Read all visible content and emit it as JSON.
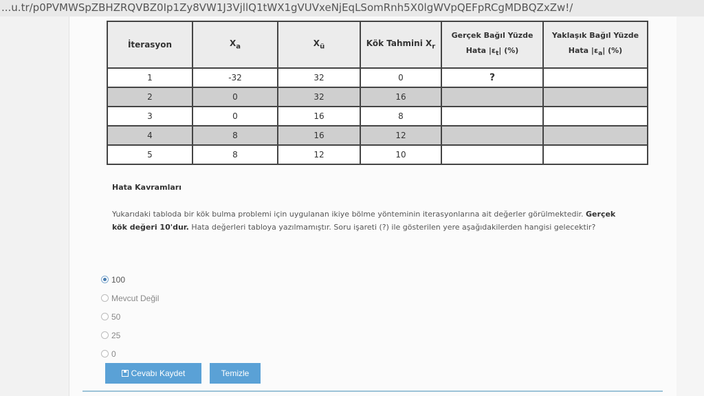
{
  "browser": {
    "url": "...u.tr/p0PVMWSpZBHZRQVBZ0Ip1Zy8VW1J3VjllQ1tWX1gVUVxeNjEqLSomRnh5X0lgWVpQEFpRCgMDBQZxZw!/"
  },
  "table": {
    "headers": {
      "iteration": "İterasyon",
      "xa_main": "X",
      "xa_sub": "a",
      "xu_main": "X",
      "xu_sub": "ü",
      "root_main": "Kök Tahmini X",
      "root_sub": "r",
      "true_err_line1": "Gerçek Bağıl Yüzde",
      "true_err_line2_pre": "Hata |ε",
      "true_err_line2_sub": "t",
      "true_err_line2_post": "| (%)",
      "approx_err_line1": "Yaklaşık Bağıl Yüzde",
      "approx_err_line2_pre": "Hata |ε",
      "approx_err_line2_sub": "a",
      "approx_err_line2_post": "| (%)"
    },
    "rows": [
      {
        "iter": "1",
        "xa": "-32",
        "xu": "32",
        "xr": "0",
        "et": "?",
        "ea": ""
      },
      {
        "iter": "2",
        "xa": "0",
        "xu": "32",
        "xr": "16",
        "et": "",
        "ea": ""
      },
      {
        "iter": "3",
        "xa": "0",
        "xu": "16",
        "xr": "8",
        "et": "",
        "ea": ""
      },
      {
        "iter": "4",
        "xa": "8",
        "xu": "16",
        "xr": "12",
        "et": "",
        "ea": ""
      },
      {
        "iter": "5",
        "xa": "8",
        "xu": "12",
        "xr": "10",
        "et": "",
        "ea": ""
      }
    ]
  },
  "section_title": "Hata Kavramları",
  "question": {
    "part1": "Yukarıdaki tabloda bir kök bulma problemi için uygulanan ikiye bölme yönteminin iterasyonlarına ait değerler görülmektedir. ",
    "bold": "Gerçek kök değeri 10'dur.",
    "part2": " Hata değerleri tabloya yazılmamıştır. Soru işareti (?) ile gösterilen yere aşağıdakilerden hangisi gelecektir?"
  },
  "options": [
    {
      "label": "100",
      "checked": true
    },
    {
      "label": "Mevcut Değil",
      "checked": false
    },
    {
      "label": "50",
      "checked": false
    },
    {
      "label": "25",
      "checked": false
    },
    {
      "label": "0",
      "checked": false
    }
  ],
  "buttons": {
    "save_label": "Cevabı Kaydet",
    "clear_label": "Temizle"
  },
  "colors": {
    "button": "#5aa1d6",
    "header_bg": "#ececec",
    "alt_row_bg": "#cfcfcf"
  }
}
